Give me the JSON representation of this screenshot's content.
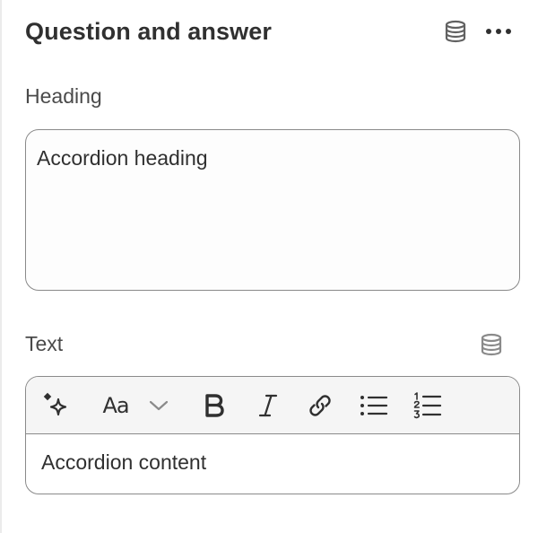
{
  "panel": {
    "title": "Question and answer",
    "icons": {
      "dynamic_source": "database-icon",
      "more": "more-horizontal-icon"
    }
  },
  "heading_field": {
    "label": "Heading",
    "value": "Accordion heading"
  },
  "text_field": {
    "label": "Text",
    "font_glyph": "Aa",
    "toolbar": [
      "magic-sparkle-icon",
      "font-style-icon",
      "chevron-down-icon",
      "bold-icon",
      "italic-icon",
      "link-icon",
      "bulleted-list-icon",
      "numbered-list-icon"
    ],
    "value": "Accordion content"
  },
  "colors": {
    "text": "#303030",
    "border": "#8a8a8a",
    "toolbar_bg": "#f5f5f5",
    "icon": "#4a4a4a"
  }
}
